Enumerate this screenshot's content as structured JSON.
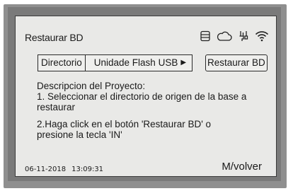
{
  "header": {
    "title": "Restaurar BD",
    "icons": [
      "database-icon",
      "cloud-icon",
      "usb-plug-icon",
      "wifi-icon"
    ]
  },
  "directory": {
    "label": "Directorio",
    "value": "Unidade Flash USB",
    "arrow": "▶"
  },
  "restore_button": {
    "label": "Restaurar BD"
  },
  "description": {
    "heading": "Descripcion del Proyecto:",
    "step1_line1": "1. Seleccionar el directorio de origen de la base a",
    "step1_line2": "restaurar",
    "step2_line1": "2.Haga click en el botón 'Restaurar BD' o",
    "step2_line2": "presione la tecla 'IN'"
  },
  "footer": {
    "date": "06-11-2018",
    "time": "13:09:31",
    "back_label": "M/volver"
  }
}
